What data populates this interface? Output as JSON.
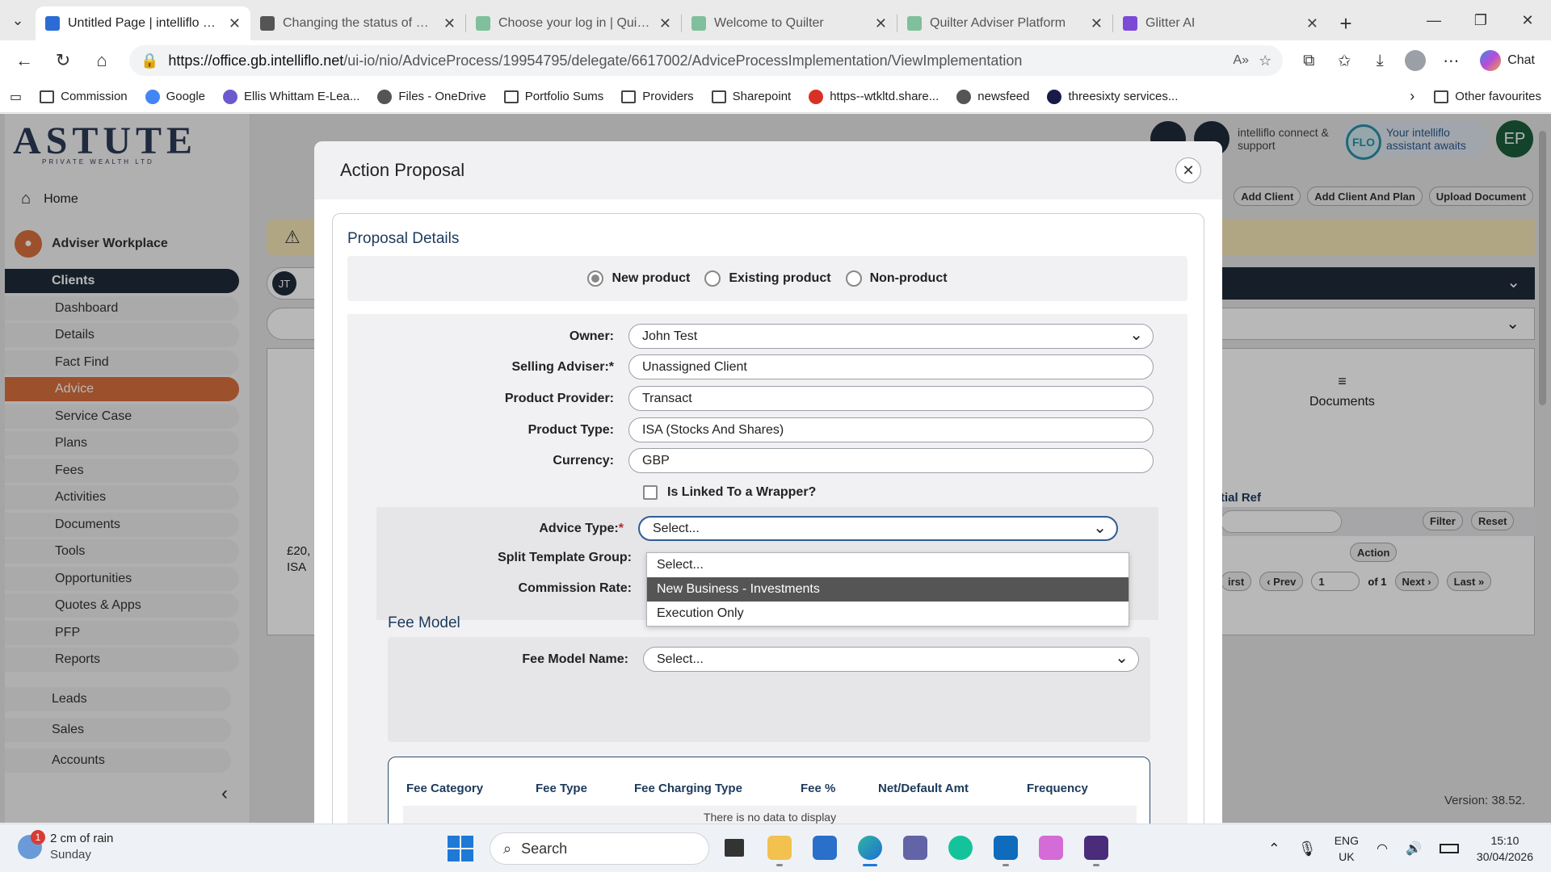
{
  "browser": {
    "tabs": [
      {
        "title": "Untitled Page | intelliflo office",
        "icon": "intelliflo-icon",
        "color": "#2b6bd6",
        "active": true
      },
      {
        "title": "Changing the status of a plan",
        "icon": "globe-icon",
        "color": "#555555",
        "active": false
      },
      {
        "title": "Choose your log in | Quilter",
        "icon": "quilter-icon",
        "color": "#7fbf9c",
        "active": false
      },
      {
        "title": "Welcome to Quilter",
        "icon": "quilter-icon",
        "color": "#7fbf9c",
        "active": false
      },
      {
        "title": "Quilter Adviser Platform",
        "icon": "quilter-icon",
        "color": "#7fbf9c",
        "active": false
      },
      {
        "title": "Glitter AI",
        "icon": "glitter-icon",
        "color": "#7b4bd8",
        "active": false
      }
    ],
    "url_host": "https://office.gb.intelliflo.net",
    "url_path": "/ui-io/nio/AdviceProcess/19954795/delegate/6617002/AdviceProcessImplementation/ViewImplementation",
    "chat_label": "Chat",
    "bookmarks": [
      {
        "label": "Commission",
        "icon": "folder-icon"
      },
      {
        "label": "Google",
        "icon": "google-icon"
      },
      {
        "label": "Ellis Whittam E-Lea...",
        "icon": "ellis-icon"
      },
      {
        "label": "Files - OneDrive",
        "icon": "globe-icon"
      },
      {
        "label": "Portfolio Sums",
        "icon": "folder-icon"
      },
      {
        "label": "Providers",
        "icon": "folder-icon"
      },
      {
        "label": "Sharepoint",
        "icon": "folder-icon"
      },
      {
        "label": "https--wtkltd.share...",
        "icon": "pdf-icon"
      },
      {
        "label": "newsfeed",
        "icon": "globe-icon"
      },
      {
        "label": "threesixty services...",
        "icon": "threesixty-icon"
      }
    ],
    "other_favourites": "Other favourites"
  },
  "app": {
    "logo_text": "ASTUTE",
    "logo_sub": "PRIVATE WEALTH LTD",
    "home": "Home",
    "workplace": "Adviser Workplace",
    "sidebar_clients": [
      "Clients",
      "Dashboard",
      "Details",
      "Fact Find",
      "Advice",
      "Service Case",
      "Plans",
      "Fees",
      "Activities",
      "Documents",
      "Tools",
      "Opportunities",
      "Quotes & Apps",
      "PFP",
      "Reports"
    ],
    "sidebar_bottom": [
      "Leads",
      "Sales",
      "Accounts"
    ],
    "help_text": "intelliflo connect & support",
    "flo_text": "Your intelliflo assistant awaits",
    "flo_badge": "FLO",
    "avatar_initials": "EP",
    "toolbar_buttons": [
      "Add Client",
      "Add Client And Plan",
      "Upload Document"
    ],
    "client_initials": "JT",
    "documents_tab": "Documents",
    "filter": "Filter",
    "reset": "Reset",
    "action": "Action",
    "pager": {
      "prev": "‹ Prev",
      "page": "1",
      "of": "of 1",
      "next": "Next ›",
      "last": "Last »",
      "first": "irst"
    },
    "tial_ref": "tial Ref",
    "amount_snippet": "£20,",
    "isa_snippet": "ISA",
    "version": "Version: 38.52."
  },
  "modal": {
    "title": "Action Proposal",
    "section_title": "Proposal Details",
    "radios": [
      {
        "label": "New product",
        "checked": true
      },
      {
        "label": "Existing product",
        "checked": false
      },
      {
        "label": "Non-product",
        "checked": false
      }
    ],
    "owner_label": "Owner:",
    "owner_value": "John Test",
    "selling_adviser_label": "Selling Adviser:*",
    "selling_adviser_value": "Unassigned Client",
    "provider_label": "Product Provider:",
    "provider_value": "Transact",
    "product_type_label": "Product Type:",
    "product_type_value": "ISA (Stocks And Shares)",
    "currency_label": "Currency:",
    "currency_value": "GBP",
    "linked_label": "Is Linked To a Wrapper?",
    "advice_type_label": "Advice Type:",
    "advice_type_value": "Select...",
    "split_label": "Split Template Group:",
    "commission_label": "Commission Rate:",
    "dropdown_options": [
      "Select...",
      "New Business - Investments",
      "Execution Only"
    ],
    "dropdown_highlight": 1,
    "fee_model_title": "Fee Model",
    "fee_model_label": "Fee Model Name:",
    "fee_model_value": "Select...",
    "fee_columns": [
      "Fee Category",
      "Fee Type",
      "Fee Charging Type",
      "Fee %",
      "Net/Default Amt",
      "Frequency"
    ],
    "fee_empty": "There is no data to display"
  },
  "taskbar": {
    "weather_main": "2 cm of rain",
    "weather_sub": "Sunday",
    "weather_badge": "1",
    "search": "Search",
    "lang_top": "ENG",
    "lang_bottom": "UK",
    "time": "15:10",
    "date": "30/04/2026"
  }
}
